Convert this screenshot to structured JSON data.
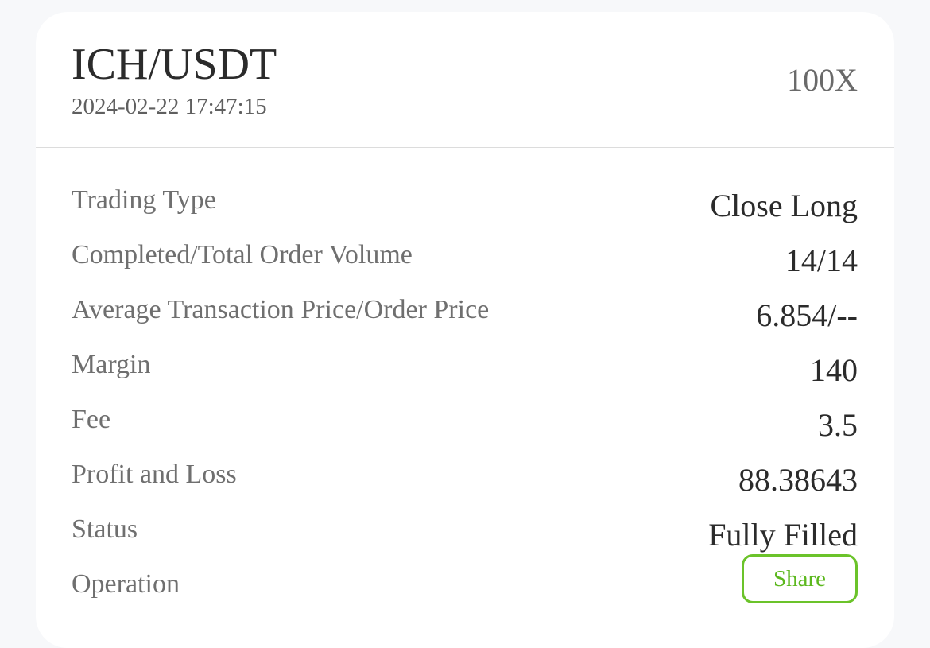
{
  "order": {
    "pair": "ICH/USDT",
    "timestamp": "2024-02-22 17:47:15",
    "leverage": "100X"
  },
  "details": [
    {
      "label": "Trading Type",
      "value": "Close Long"
    },
    {
      "label": "Completed/Total Order Volume",
      "value": "14/14"
    },
    {
      "label": "Average Transaction Price/Order Price",
      "value": "6.854/--"
    },
    {
      "label": "Margin",
      "value": "140"
    },
    {
      "label": "Fee",
      "value": "3.5"
    },
    {
      "label": "Profit and Loss",
      "value": "88.38643"
    },
    {
      "label": "Status",
      "value": "Fully Filled"
    }
  ],
  "operation": {
    "label": "Operation",
    "share_label": "Share"
  },
  "colors": {
    "accent": "#6bc32a",
    "card_background": "#ffffff",
    "page_background": "#f7f8fa"
  }
}
